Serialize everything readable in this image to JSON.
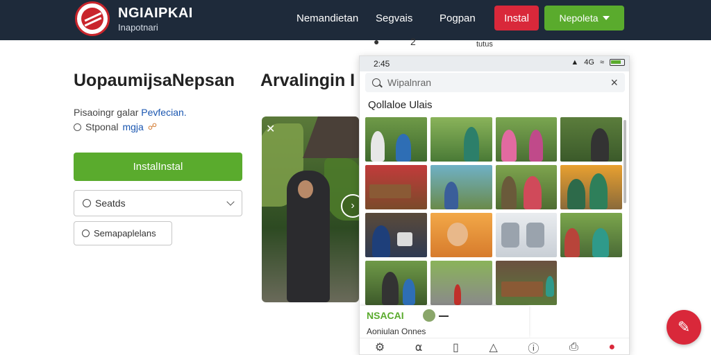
{
  "header": {
    "brand_name": "NGIAIPKAI",
    "brand_sub": "Inapotnari",
    "nav": [
      "Nemandietan",
      "Segvais",
      "Pogpan"
    ],
    "red_button": "Instal",
    "green_button": "Nepoleta"
  },
  "left": {
    "title": "UopaumijsaNepsan",
    "desc_text": "Pisaoingr galar",
    "desc_link": "Pevfecian.",
    "radio_text": "Stponal",
    "radio_link": "mgja",
    "install_button": "InstalInstal",
    "select_value": "Seatds",
    "secondary_button": "Semapaplelans"
  },
  "middle": {
    "title": "Arvalingin I"
  },
  "stray": {
    "left": "2",
    "mid": "tutus"
  },
  "phone": {
    "status_time": "2:45",
    "status_extra": "4G",
    "search_placeholder": "Wipalnran",
    "section_title": "Qollaloe Ulais",
    "card_title": "NSACAI",
    "card_sub": "Aoniulan Onnes"
  },
  "colors": {
    "nav_bg": "#1e2a3a",
    "accent_green": "#5aab2d",
    "accent_red": "#d9283a",
    "link_blue": "#1a56b0"
  },
  "icons": {
    "bottom_nav": [
      "home-icon",
      "headphones-icon",
      "book-icon",
      "bag-icon",
      "info-icon",
      "share-icon",
      "chat-icon"
    ],
    "fab": "edit-icon"
  }
}
